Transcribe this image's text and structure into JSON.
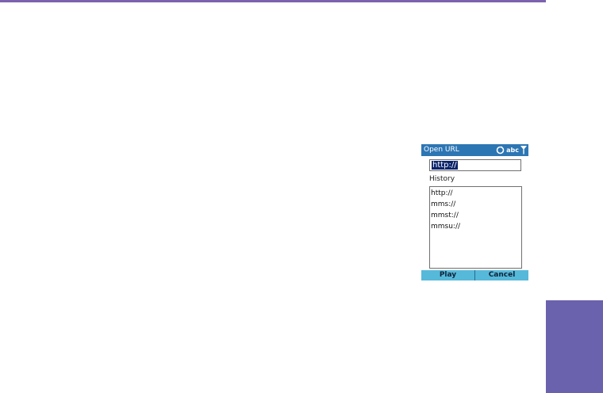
{
  "colors": {
    "top_rule": "#7b63ad",
    "side_tab": "#6a62ad",
    "titlebar": "#2d76b4",
    "softkey_bar": "#56b9d9",
    "selection": "#0a246a"
  },
  "dialog": {
    "title": "Open URL",
    "status": {
      "ime_text": "abc",
      "icons": [
        "sync-icon",
        "signal-icon"
      ]
    },
    "url_field": {
      "value": "http://"
    },
    "history_label": "History",
    "history_items": [
      "http://",
      "mms://",
      "mmst://",
      "mmsu://"
    ],
    "softkeys": {
      "left": "Play",
      "right": "Cancel"
    }
  }
}
